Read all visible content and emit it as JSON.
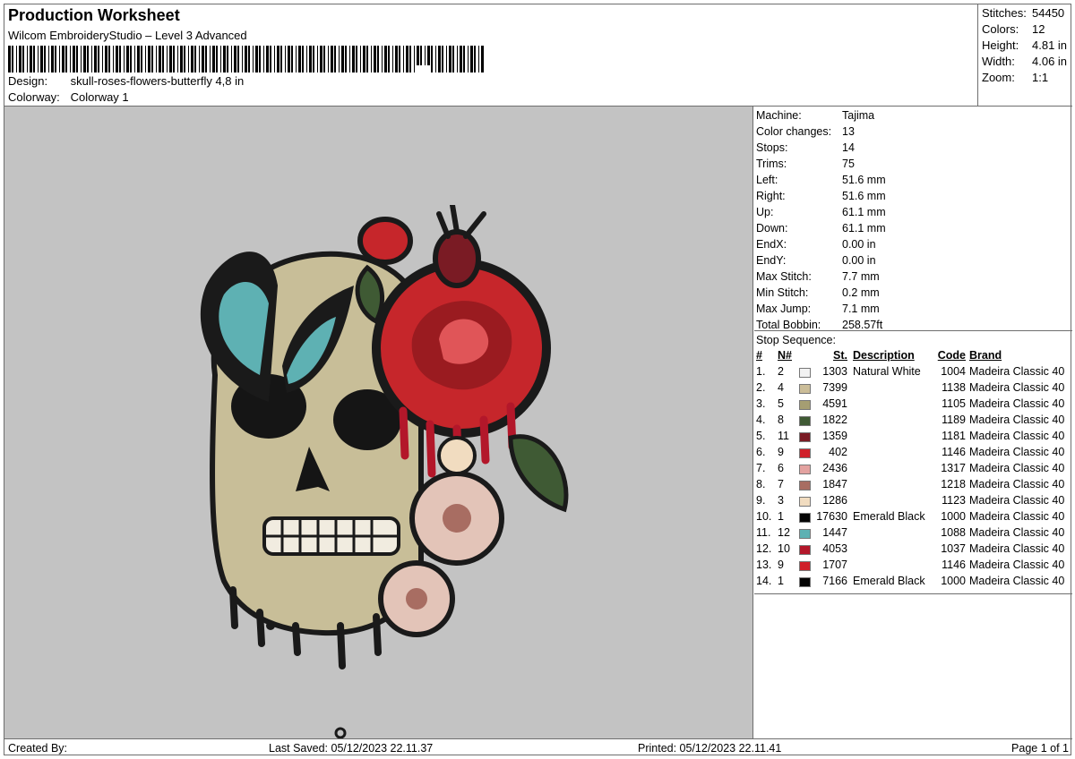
{
  "header": {
    "title": "Production Worksheet",
    "software": "Wilcom EmbroideryStudio – Level 3 Advanced",
    "design_label": "Design:",
    "design_value": "skull-roses-flowers-butterfly 4,8 in",
    "colorway_label": "Colorway:",
    "colorway_value": "Colorway 1"
  },
  "summary": [
    {
      "label": "Stitches:",
      "value": "54450"
    },
    {
      "label": "Colors:",
      "value": "12"
    },
    {
      "label": "Height:",
      "value": "4.81 in"
    },
    {
      "label": "Width:",
      "value": "4.06 in"
    },
    {
      "label": "Zoom:",
      "value": "1:1"
    }
  ],
  "specs": [
    {
      "label": "Machine:",
      "value": "Tajima"
    },
    {
      "label": "Color changes:",
      "value": "13"
    },
    {
      "label": "Stops:",
      "value": "14"
    },
    {
      "label": "Trims:",
      "value": "75"
    },
    {
      "label": "Left:",
      "value": "51.6 mm"
    },
    {
      "label": "Right:",
      "value": "51.6 mm"
    },
    {
      "label": "Up:",
      "value": "61.1 mm"
    },
    {
      "label": "Down:",
      "value": "61.1 mm"
    },
    {
      "label": "EndX:",
      "value": "0.00 in"
    },
    {
      "label": "EndY:",
      "value": "0.00 in"
    },
    {
      "label": "Max Stitch:",
      "value": "7.7 mm"
    },
    {
      "label": "Min Stitch:",
      "value": "0.2 mm"
    },
    {
      "label": "Max Jump:",
      "value": "7.1 mm"
    },
    {
      "label": "Total Bobbin:",
      "value": "258.57ft"
    }
  ],
  "stop_sequence": {
    "title": "Stop Sequence:",
    "columns": {
      "idx": "#",
      "n": "N#",
      "st": "St.",
      "desc": "Description",
      "code": "Code",
      "brand": "Brand"
    },
    "rows": [
      {
        "idx": "1.",
        "n": "2",
        "color": "#f2f2f2",
        "st": "1303",
        "desc": "Natural White",
        "code": "1004",
        "brand": "Madeira Classic 40"
      },
      {
        "idx": "2.",
        "n": "4",
        "color": "#cbbd98",
        "st": "7399",
        "desc": "",
        "code": "1138",
        "brand": "Madeira Classic 40"
      },
      {
        "idx": "3.",
        "n": "5",
        "color": "#a59e72",
        "st": "4591",
        "desc": "",
        "code": "1105",
        "brand": "Madeira Classic 40"
      },
      {
        "idx": "4.",
        "n": "8",
        "color": "#3f5a34",
        "st": "1822",
        "desc": "",
        "code": "1189",
        "brand": "Madeira Classic 40"
      },
      {
        "idx": "5.",
        "n": "11",
        "color": "#7a1b24",
        "st": "1359",
        "desc": "",
        "code": "1181",
        "brand": "Madeira Classic 40"
      },
      {
        "idx": "6.",
        "n": "9",
        "color": "#d0202a",
        "st": "402",
        "desc": "",
        "code": "1146",
        "brand": "Madeira Classic 40"
      },
      {
        "idx": "7.",
        "n": "6",
        "color": "#e3a2a0",
        "st": "2436",
        "desc": "",
        "code": "1317",
        "brand": "Madeira Classic 40"
      },
      {
        "idx": "8.",
        "n": "7",
        "color": "#a86d62",
        "st": "1847",
        "desc": "",
        "code": "1218",
        "brand": "Madeira Classic 40"
      },
      {
        "idx": "9.",
        "n": "3",
        "color": "#f1dcc0",
        "st": "1286",
        "desc": "",
        "code": "1123",
        "brand": "Madeira Classic 40"
      },
      {
        "idx": "10.",
        "n": "1",
        "color": "#050505",
        "st": "17630",
        "desc": "Emerald Black",
        "code": "1000",
        "brand": "Madeira Classic 40"
      },
      {
        "idx": "11.",
        "n": "12",
        "color": "#5eb1b3",
        "st": "1447",
        "desc": "",
        "code": "1088",
        "brand": "Madeira Classic 40"
      },
      {
        "idx": "12.",
        "n": "10",
        "color": "#b3172a",
        "st": "4053",
        "desc": "",
        "code": "1037",
        "brand": "Madeira Classic 40"
      },
      {
        "idx": "13.",
        "n": "9",
        "color": "#d0202a",
        "st": "1707",
        "desc": "",
        "code": "1146",
        "brand": "Madeira Classic 40"
      },
      {
        "idx": "14.",
        "n": "1",
        "color": "#050505",
        "st": "7166",
        "desc": "Emerald Black",
        "code": "1000",
        "brand": "Madeira Classic 40"
      }
    ]
  },
  "footer": {
    "created_by": "Created By:",
    "last_saved": "Last Saved: 05/12/2023 22.11.37",
    "printed": "Printed: 05/12/2023 22.11.41",
    "page": "Page 1 of 1"
  }
}
